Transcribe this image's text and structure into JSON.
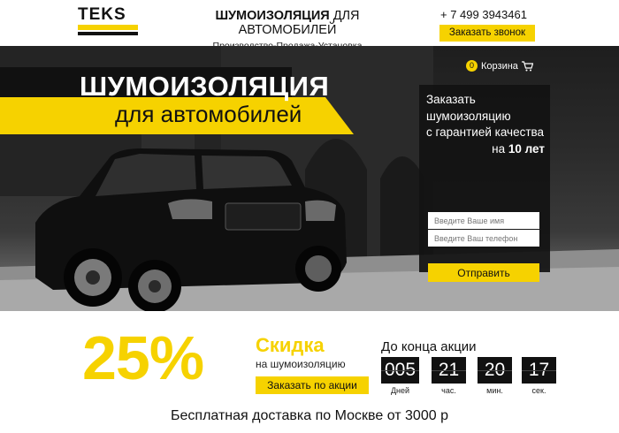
{
  "header": {
    "logo_text": "TEKS",
    "title_bold": "ШУМОИЗОЛЯЦИЯ",
    "title_rest": "ДЛЯ АВТОМОБИЛЕЙ",
    "subtitle": "Производство-Продажа-Установка",
    "phone": "+ 7 499 3943461",
    "call_button": "Заказать звонок"
  },
  "hero": {
    "title_line1": "ШУМОИЗОЛЯЦИЯ",
    "title_line2": "для автомобилей",
    "cart": {
      "count": "0",
      "label": "Корзина",
      "icon": "cart-icon"
    }
  },
  "form": {
    "line1": "Заказать",
    "line2": "шумоизоляцию",
    "line3": "с гарантией качества",
    "line4_prefix": "на",
    "line4_bold": "10 лет",
    "name_placeholder": "Введите Ваше имя",
    "phone_placeholder": "Введите Ваш телефон",
    "submit_label": "Отправить"
  },
  "promo": {
    "percent": "25%",
    "discount_title": "Скидка",
    "discount_sub": "на шумоизоляцию",
    "button": "Заказать по акции",
    "countdown_title": "До конца акции",
    "countdown": [
      {
        "value": "005",
        "unit": "Дней"
      },
      {
        "value": "21",
        "unit": "час."
      },
      {
        "value": "20",
        "unit": "мин."
      },
      {
        "value": "17",
        "unit": "сек."
      }
    ],
    "delivery": "Бесплатная доставка по Москве от 3000 р"
  },
  "colors": {
    "accent": "#f6d200",
    "dark": "#111111"
  }
}
